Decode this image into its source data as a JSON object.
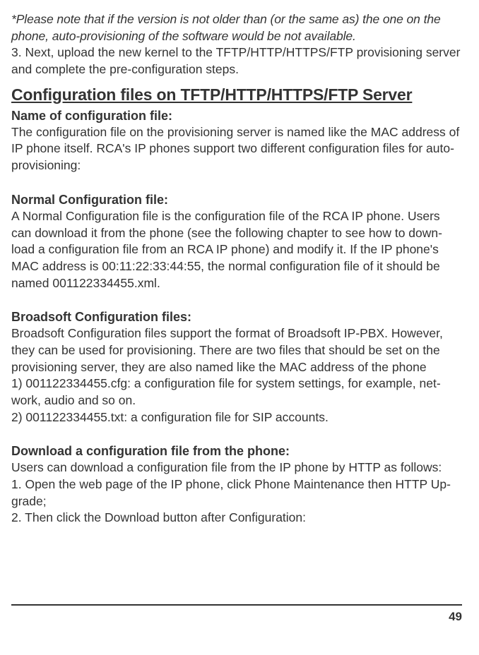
{
  "note": " *Please note that if the version is not older than (or the same as) the one on the phone, auto-provisioning of the software would be not available.",
  "step3": "3. Next, upload the new kernel to the TFTP/HTTP/HTTPS/FTP provisioning server and complete the pre-configuration steps.",
  "heading": "Configuration files on TFTP/HTTP/HTTPS/FTP Server",
  "nameConfigHeading": " Name of configuration file:",
  "nameConfigBody": "The configuration file on the provisioning server is named like the MAC address of IP phone itself. RCA's IP phones support two different configuration files for auto-provisioning:",
  "normalHeading": "Normal Configuration file:",
  "normalBody": "A Normal Configuration file is the configuration file of the RCA IP phone. Users can download it from the phone (see the following chapter to see how to down-load a configuration file from an RCA IP phone) and modify it. If the IP phone's MAC address is 00:11:22:33:44:55, the normal configuration file of it should be named 001122334455.xml.",
  "broadsoftHeading": "Broadsoft Configuration files:",
  "broadsoftBody1": "Broadsoft Configuration files support the format of Broadsoft IP-PBX. However, they can be used for provisioning. There are two files that should be set on the provisioning server, they are also named like the MAC address of the phone",
  "broadsoftItem1": "1) 001122334455.cfg: a configuration file for system settings, for example, net-work, audio and so on.",
  "broadsoftItem2": "2) 001122334455.txt: a configuration file for SIP accounts.",
  "downloadHeading": "Download a configuration file from the phone:",
  "downloadBody1": "Users can download a configuration file from the IP phone by HTTP as follows:",
  "downloadStep1": "1. Open the web page of the IP phone, click Phone Maintenance then HTTP Up-grade;",
  "downloadStep2": "2. Then click the Download button after Configuration:",
  "pageNumber": "49"
}
